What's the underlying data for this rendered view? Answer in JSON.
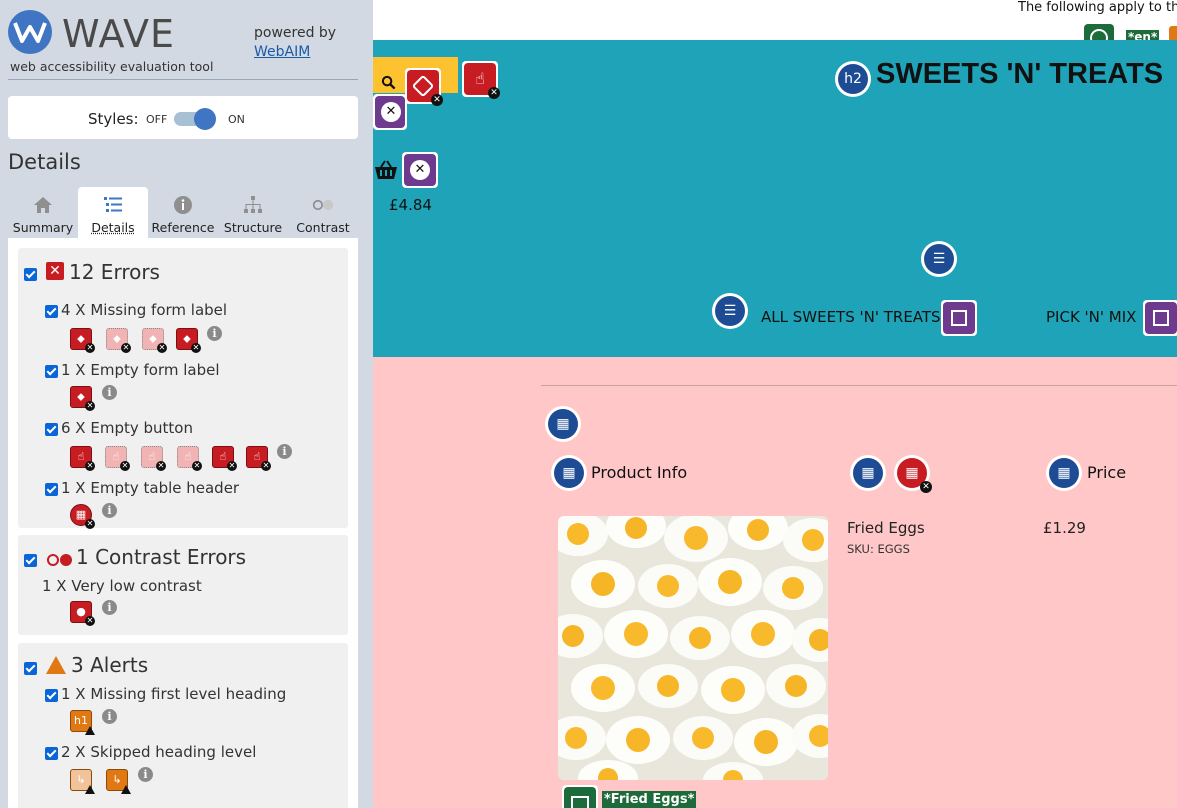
{
  "sidebar": {
    "logo_text": "WAVE",
    "tagline": "web accessibility evaluation tool",
    "powered_by": "powered by",
    "webaim_link": "WebAIM",
    "styles": {
      "label": "Styles:",
      "off": "OFF",
      "on": "ON",
      "state": "on"
    },
    "details_heading": "Details",
    "tabs": [
      {
        "label": "Summary",
        "icon": "home-icon",
        "active": false
      },
      {
        "label": "Details",
        "icon": "list-icon",
        "active": true
      },
      {
        "label": "Reference",
        "icon": "info-icon",
        "active": false
      },
      {
        "label": "Structure",
        "icon": "hierarchy-icon",
        "active": false
      },
      {
        "label": "Contrast",
        "icon": "contrast-icon",
        "active": false
      }
    ],
    "errors": {
      "title": "12 Errors",
      "items": [
        {
          "label": "4 X Missing form label",
          "icons": 4
        },
        {
          "label": "1 X Empty form label",
          "icons": 1
        },
        {
          "label": "6 X Empty button",
          "icons": 6
        },
        {
          "label": "1 X Empty table header",
          "icons": 1
        }
      ]
    },
    "contrast": {
      "title": "1 Contrast Errors",
      "items": [
        {
          "label": "1 X Very low contrast",
          "icons": 1
        }
      ]
    },
    "alerts": {
      "title": "3 Alerts",
      "items": [
        {
          "label": "1 X Missing first level heading",
          "icons": 1
        },
        {
          "label": "2 X Skipped heading level",
          "icons": 2
        }
      ]
    }
  },
  "page": {
    "top_notice": "The following apply to th",
    "lang_badge": "*en*",
    "heading_badge": "h2",
    "site_title": "SWEETS 'N' TREATS",
    "basket_total": "£4.84",
    "nav": [
      "ALL SWEETS 'N' TREATS",
      "PICK 'N' MIX"
    ],
    "table_headers": {
      "product": "Product Info",
      "price": "Price"
    },
    "product": {
      "name": "Fried Eggs",
      "sku": "SKU: EGGS",
      "price": "£1.29",
      "alt": "*Fried Eggs*"
    }
  },
  "colors": {
    "sidebar_bg": "#d2d9e2",
    "header_bg": "#1fa3b8",
    "content_bg": "#ffc7c7",
    "error_red": "#c71c22",
    "alert_orange": "#e07814",
    "wave_blue": "#1e4c94",
    "wave_purple": "#6d3a8e"
  }
}
